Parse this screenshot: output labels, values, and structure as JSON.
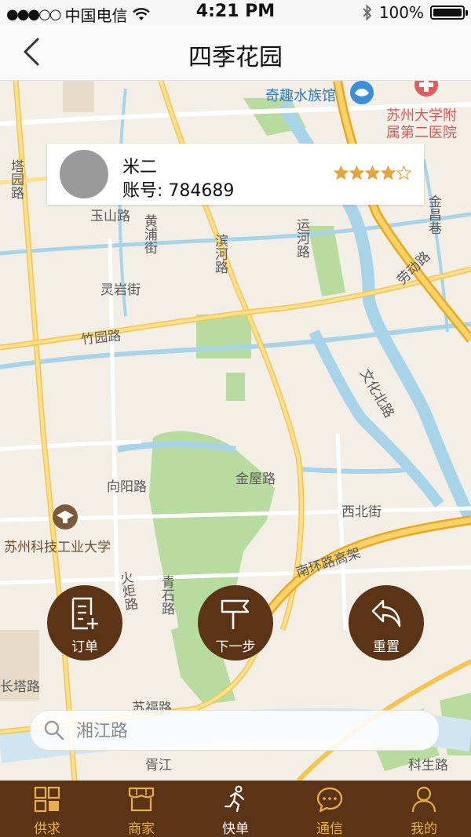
{
  "status_bar": {
    "carrier": "中国电信",
    "time": "4:21 PM",
    "battery": "100%",
    "battery_level": 1.0
  },
  "nav": {
    "title": "四季花园",
    "back_icon": "chevron-left-icon"
  },
  "map": {
    "labels": {
      "aquarium": "奇趣水族馆",
      "hospital_line1": "苏州大学附",
      "hospital_line2": "属第二医院",
      "taoyuan": "塔园路",
      "jinji": "金昌巷",
      "yushan": "玉山路",
      "huangpu": "黄浦街",
      "binhe": "滨河路",
      "yunhe": "运河路",
      "laodong": "劳动路",
      "lingyan": "灵岩街",
      "zhuyuan": "竹园路",
      "wenhuabei": "文化北路",
      "xiangyang": "向阳路",
      "jinwu": "金屋路",
      "xibei": "西北街",
      "university": "苏州科技工业大学",
      "nanhuan": "南环路高架",
      "huoju": "火炬路",
      "qingshi": "青石路",
      "changta": "长塔路",
      "sufu": "苏福路",
      "xujiang": "胥江",
      "kesheng": "科生路"
    }
  },
  "user_card": {
    "name": "米二",
    "account_label": "账号:",
    "account_number": "784689",
    "rating": 4,
    "rating_max": 5
  },
  "actions": [
    {
      "label": "订单",
      "icon": "order-icon"
    },
    {
      "label": "下一步",
      "icon": "signpost-icon"
    },
    {
      "label": "重置",
      "icon": "undo-icon"
    }
  ],
  "search": {
    "placeholder": "湘江路"
  },
  "tabs": [
    {
      "label": "供求",
      "icon": "grid-icon",
      "active": false
    },
    {
      "label": "商家",
      "icon": "store-icon",
      "active": false
    },
    {
      "label": "快单",
      "icon": "runner-icon",
      "active": true
    },
    {
      "label": "通信",
      "icon": "chat-icon",
      "active": false
    },
    {
      "label": "我的",
      "icon": "person-icon",
      "active": false
    }
  ],
  "colors": {
    "brand_brown": "#5b3416",
    "accent_gold": "#e8b04a",
    "star": "#e3a53c",
    "map_road": "#fbd26a",
    "map_water": "#a8d4ea",
    "map_green": "#b8dca0"
  }
}
